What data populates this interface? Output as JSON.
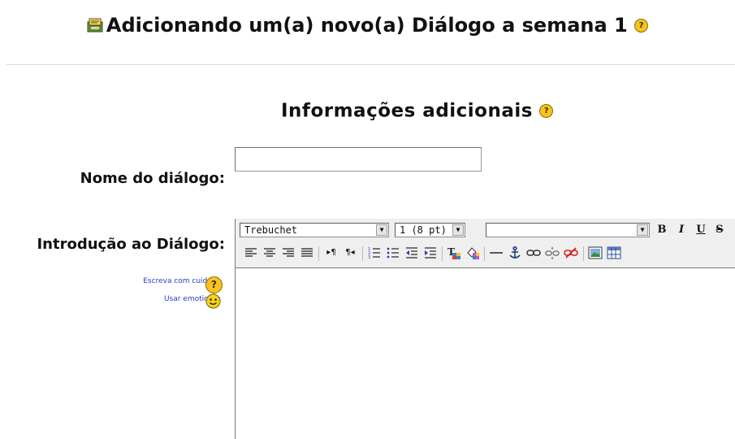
{
  "header": {
    "title": "Adicionando um(a) novo(a) Diálogo a semana 1",
    "help_glyph": "?"
  },
  "section": {
    "title": "Informações adicionais",
    "help_glyph": "?"
  },
  "form": {
    "name_label": "Nome do diálogo:",
    "name_value": "",
    "intro_label": "Introdução ao Diálogo:",
    "help_links": [
      "Escreva com cuidado",
      "Usar emoticons"
    ],
    "help_glyph": "?"
  },
  "editor": {
    "font_select": "Trebuchet",
    "size_select": "1 (8 pt)",
    "style_select": "",
    "format_buttons": {
      "bold": "B",
      "italic": "I",
      "underline": "U",
      "strike": "S"
    },
    "paragraph_buttons": {
      "ltr": "▸¶",
      "rtl": "¶◂"
    },
    "content": ""
  },
  "colors": {
    "link": "#1f3fbf",
    "help_icon": "#f6c41d",
    "toolbar_bg": "#efefef"
  },
  "icons": [
    "dialogue-icon",
    "help-icon",
    "smiley-icon",
    "align-left-icon",
    "align-center-icon",
    "align-right-icon",
    "justify-icon",
    "ordered-list-icon",
    "unordered-list-icon",
    "outdent-icon",
    "indent-icon",
    "text-color-icon",
    "highlight-icon",
    "horizontal-rule-icon",
    "anchor-icon",
    "link-icon",
    "unlink-icon",
    "no-link-icon",
    "insert-image-icon",
    "insert-table-icon"
  ]
}
